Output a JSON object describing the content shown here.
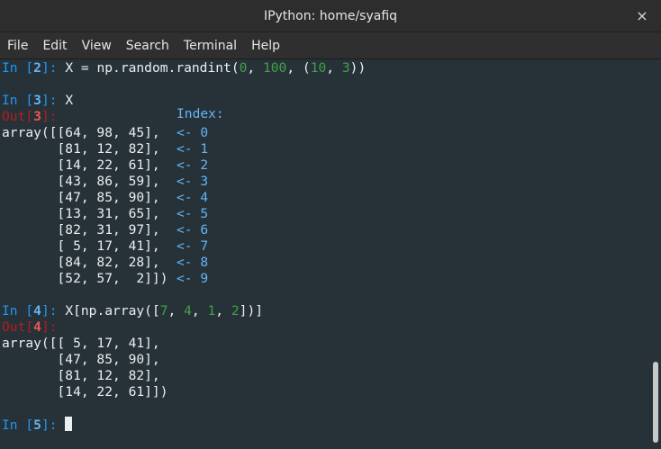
{
  "window": {
    "title": "IPython: home/syafiq",
    "close_glyph": "×"
  },
  "menu": [
    "File",
    "Edit",
    "View",
    "Search",
    "Terminal",
    "Help"
  ],
  "terminal": {
    "in2": {
      "prompt_in": "In [",
      "num": "2",
      "prompt_end": "]: ",
      "code_a": "X = np.random.randint(",
      "arg1": "0",
      "sep1": ", ",
      "arg2": "100",
      "sep2": ", (",
      "arg3": "10",
      "sep3": ", ",
      "arg4": "3",
      "code_b": "))"
    },
    "in3": {
      "prompt_in": "In [",
      "num": "3",
      "prompt_end": "]: ",
      "code": "X"
    },
    "out3": {
      "prompt_out": "Out[",
      "num": "3",
      "prompt_end": "]:"
    },
    "index_header": "Index:",
    "out3_rows": [
      "array([[64, 98, 45],",
      "       [81, 12, 82],",
      "       [14, 22, 61],",
      "       [43, 86, 59],",
      "       [47, 85, 90],",
      "       [13, 31, 65],",
      "       [82, 31, 97],",
      "       [ 5, 17, 41],",
      "       [84, 82, 28],",
      "       [52, 57,  2]])"
    ],
    "annotations": [
      "<- 0",
      "<- 1",
      "<- 2",
      "<- 3",
      "<- 4",
      "<- 5",
      "<- 6",
      "<- 7",
      "<- 8",
      "<- 9"
    ],
    "in4": {
      "prompt_in": "In [",
      "num": "4",
      "prompt_end": "]: ",
      "code_a": "X[np.array([",
      "v1": "7",
      "s1": ", ",
      "v2": "4",
      "s2": ", ",
      "v3": "1",
      "s3": ", ",
      "v4": "2",
      "code_b": "])]"
    },
    "out4": {
      "prompt_out": "Out[",
      "num": "4",
      "prompt_end": "]:"
    },
    "out4_rows": [
      "array([[ 5, 17, 41],",
      "       [47, 85, 90],",
      "       [81, 12, 82],",
      "       [14, 22, 61]])"
    ],
    "in5": {
      "prompt_in": "In [",
      "num": "5",
      "prompt_end": "]: "
    }
  },
  "colors": {
    "background": "#263238",
    "prompt_in": "#2196f3",
    "prompt_out": "#b71c1c",
    "number_literal": "#43a047",
    "annotation": "#64b5f6"
  },
  "icons": {
    "close": "close-icon"
  }
}
